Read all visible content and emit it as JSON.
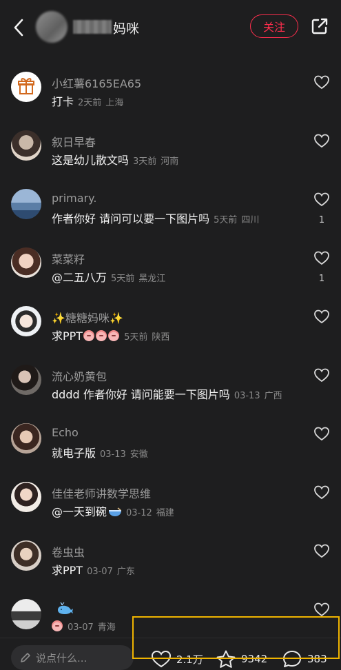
{
  "header": {
    "author_name": "妈咪",
    "follow_label": "关注"
  },
  "comments": [
    {
      "name": "小红薯6165EA65",
      "text": "打卡",
      "time": "2天前",
      "location": "上海",
      "likes": ""
    },
    {
      "name": "叙日早春",
      "text": "这是幼儿散文吗",
      "time": "3天前",
      "location": "河南",
      "likes": ""
    },
    {
      "name": "primary.",
      "text": "作者你好 请问可以要一下图片吗",
      "time": "5天前",
      "location": "四川",
      "likes": "1"
    },
    {
      "name": "菜菜籽",
      "text": "@二五八万",
      "time": "5天前",
      "location": "黑龙江",
      "likes": "1"
    },
    {
      "name": "糖糖妈咪",
      "text": "求PPT",
      "time": "5天前",
      "location": "陕西",
      "likes": ""
    },
    {
      "name": "流心奶黄包",
      "text": "dddd 作者你好 请问能要一下图片吗",
      "time": "03-13",
      "location": "广西",
      "likes": ""
    },
    {
      "name": "Echo",
      "text": "就电子版",
      "time": "03-13",
      "location": "安徽",
      "likes": ""
    },
    {
      "name": "佳佳老师讲数学思维",
      "text": "@一天到碗",
      "time": "03-12",
      "location": "福建",
      "likes": ""
    },
    {
      "name": "卷虫虫",
      "text": "求PPT",
      "time": "03-07",
      "location": "广东",
      "likes": ""
    },
    {
      "name": "",
      "text": "",
      "time": "03-07",
      "location": "青海",
      "likes": ""
    }
  ],
  "bottom": {
    "input_placeholder": "说点什么...",
    "likes_count": "2.1万",
    "collects_count": "9342",
    "comments_count": "383"
  },
  "icons": {
    "back": "chevron-left-icon",
    "share": "share-external-icon",
    "like": "heart-outline-icon",
    "collect": "star-outline-icon",
    "comment": "comment-bubble-icon",
    "edit": "pencil-icon"
  },
  "colors": {
    "background": "#1e1e1f",
    "accent": "#ff2e4d",
    "highlight": "#f0b400"
  }
}
